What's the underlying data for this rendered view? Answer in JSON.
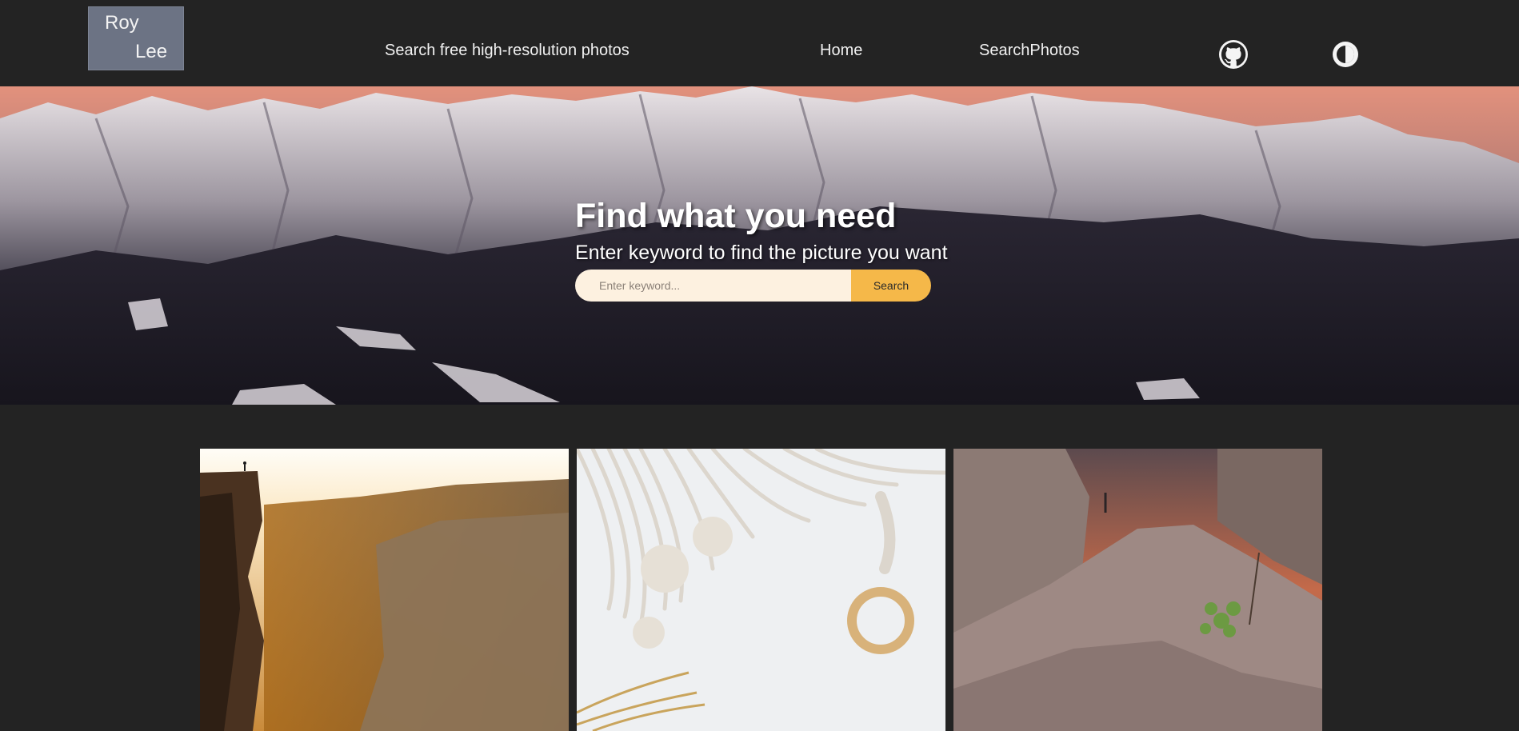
{
  "header": {
    "logo": {
      "line1": "Roy",
      "line2": "Lee"
    },
    "tagline": "Search free high-resolution photos",
    "nav": [
      {
        "label": "Home"
      },
      {
        "label": "SearchPhotos"
      }
    ],
    "icons": [
      "github-icon",
      "theme-toggle-icon"
    ]
  },
  "hero": {
    "title": "Find what you need",
    "subtitle": "Enter keyword to find the picture you want",
    "search": {
      "placeholder": "Enter keyword...",
      "value": "",
      "button_label": "Search"
    },
    "background": "snowy mountain range at dusk"
  },
  "gallery": {
    "photos": [
      {
        "subject": "person on cliff above sunlit canyon"
      },
      {
        "subject": "white macrame with wooden ring"
      },
      {
        "subject": "boulders with small plant at sunset"
      }
    ]
  },
  "colors": {
    "background": "#232323",
    "logo_bg": "#6c7384",
    "search_input_bg": "#fdf1e0",
    "search_button_bg": "#f5b849"
  }
}
